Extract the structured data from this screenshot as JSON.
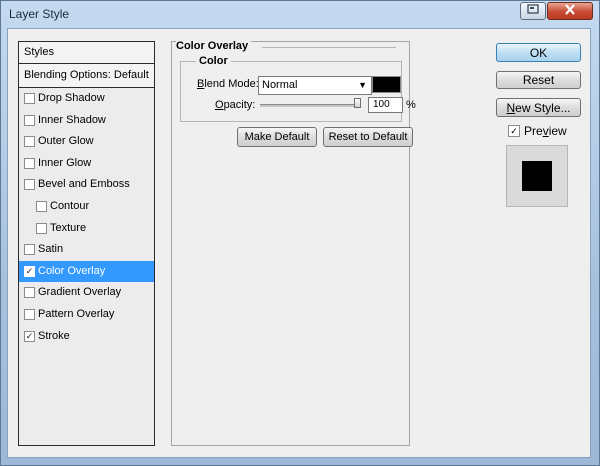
{
  "window": {
    "title": "Layer Style",
    "help_icon": "help-icon",
    "close_icon": "close-icon"
  },
  "styles_panel": {
    "header": "Styles",
    "blending_options": "Blending Options: Default",
    "items": [
      {
        "label": "Drop Shadow",
        "checked": false,
        "selected": false,
        "indent": false
      },
      {
        "label": "Inner Shadow",
        "checked": false,
        "selected": false,
        "indent": false
      },
      {
        "label": "Outer Glow",
        "checked": false,
        "selected": false,
        "indent": false
      },
      {
        "label": "Inner Glow",
        "checked": false,
        "selected": false,
        "indent": false
      },
      {
        "label": "Bevel and Emboss",
        "checked": false,
        "selected": false,
        "indent": false
      },
      {
        "label": "Contour",
        "checked": false,
        "selected": false,
        "indent": true
      },
      {
        "label": "Texture",
        "checked": false,
        "selected": false,
        "indent": true
      },
      {
        "label": "Satin",
        "checked": false,
        "selected": false,
        "indent": false
      },
      {
        "label": "Color Overlay",
        "checked": true,
        "selected": true,
        "indent": false
      },
      {
        "label": "Gradient Overlay",
        "checked": false,
        "selected": false,
        "indent": false
      },
      {
        "label": "Pattern Overlay",
        "checked": false,
        "selected": false,
        "indent": false
      },
      {
        "label": "Stroke",
        "checked": true,
        "selected": false,
        "indent": false
      }
    ]
  },
  "color_overlay": {
    "group_title": "Color Overlay",
    "fieldset_label": "Color",
    "blend_mode_label_u": "B",
    "blend_mode_label_rest": "lend Mode:",
    "blend_mode_value": "Normal",
    "overlay_color": "#000000",
    "opacity_label_u": "O",
    "opacity_label_rest": "pacity:",
    "opacity_value": "100",
    "opacity_unit": "%",
    "make_default": "Make Default",
    "reset_to_default": "Reset to Default"
  },
  "actions": {
    "ok": "OK",
    "reset": "Reset",
    "new_style_u": "N",
    "new_style_rest": "ew Style...",
    "preview_u": "v",
    "preview_pre": "Pre",
    "preview_post": "iew",
    "preview_checked": true
  },
  "colors": {
    "selection": "#3399ff",
    "dialog_bg": "#efefef"
  }
}
